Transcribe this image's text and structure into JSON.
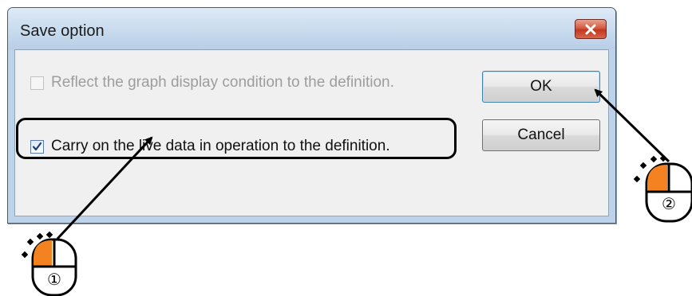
{
  "dialog": {
    "title": "Save option",
    "close_icon": "close-x-icon",
    "options": [
      {
        "label": "Reflect the graph display condition to the definition.",
        "checked": false,
        "enabled": false
      },
      {
        "label": "Carry on the live data in operation to the definition.",
        "checked": true,
        "enabled": true
      }
    ],
    "buttons": {
      "ok": "OK",
      "cancel": "Cancel"
    }
  },
  "annotations": {
    "step1": "①",
    "step2": "②",
    "mouse_icon": "mouse-left-click-icon",
    "highlight_color": "#000000",
    "mouse_button_color": "#f58220"
  },
  "colors": {
    "title_bar": "#c8dbee",
    "client_bg": "#f0f0f0",
    "close_button": "#c2361f"
  }
}
